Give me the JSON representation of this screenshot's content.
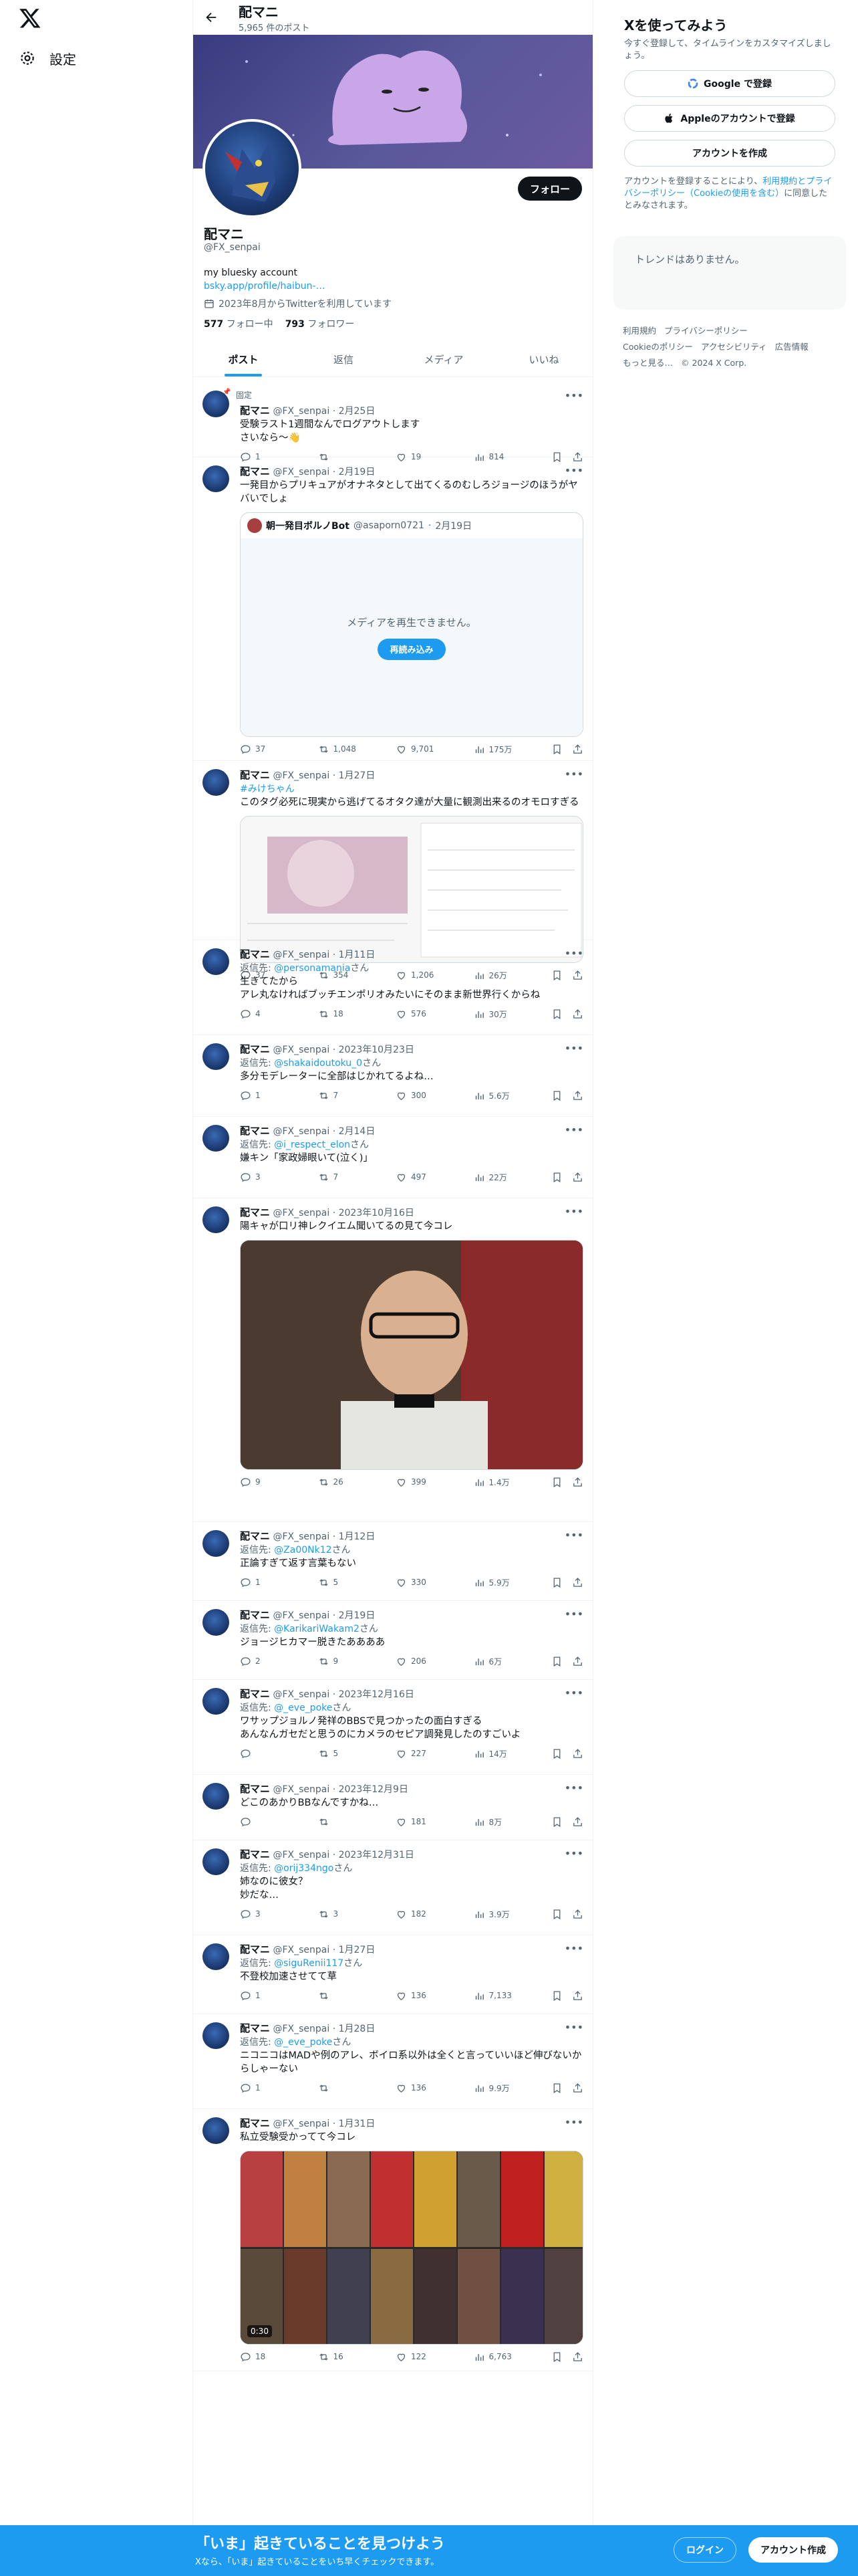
{
  "nav": {
    "settings": "設定"
  },
  "header": {
    "name": "配マニ",
    "posts": "5,965 件のポスト"
  },
  "profile": {
    "follow": "フォロー",
    "name": "配マニ",
    "handle": "@FX_senpai",
    "bio": "my bluesky account",
    "link": "bsky.app/profile/haibun-…",
    "joined": "2023年8月からTwitterを利用しています",
    "following_count": "577",
    "following_label": "フォロー中",
    "followers_count": "793",
    "followers_label": "フォロワー"
  },
  "tabs": [
    "ポスト",
    "返信",
    "メディア",
    "いいね"
  ],
  "tweets": [
    {
      "pinned": "固定",
      "name": "配マニ",
      "handle": "@FX_senpai",
      "date": "2月25日",
      "text": "受験ラスト1週間なんでログアウトします\nさいなら〜👋",
      "replies": "1",
      "rts": "",
      "likes": "19",
      "views": "814"
    },
    {
      "name": "配マニ",
      "handle": "@FX_senpai",
      "date": "2月19日",
      "text": "一発目からプリキュアがオナネタとして出てくるのむしろジョージのほうがヤバいでしょ",
      "quote": {
        "name": "朝一発目ボルノBot",
        "handle": "@asaporn0721",
        "date": "2月19日",
        "msg": "メディアを再生できません。",
        "btn": "再読み込み"
      },
      "replies": "37",
      "rts": "1,048",
      "likes": "9,701",
      "views": "175万"
    },
    {
      "name": "配マニ",
      "handle": "@FX_senpai",
      "date": "1月27日",
      "tag": "#みけちゃん",
      "text": "このタグ必死に現実から逃げてるオタク達が大量に観測出来るのオモロすぎる",
      "replies": "37",
      "rts": "354",
      "likes": "1,206",
      "views": "26万"
    },
    {
      "name": "配マニ",
      "handle": "@FX_senpai",
      "date": "1月11日",
      "reply_to": "@personamania",
      "text": "生きてたから\nアレ丸なければブッチエンポリオみたいにそのまま新世界行くからね",
      "replies": "4",
      "rts": "18",
      "likes": "576",
      "views": "30万"
    },
    {
      "name": "配マニ",
      "handle": "@FX_senpai",
      "date": "2023年10月23日",
      "reply_to": "@shakaidoutoku_0",
      "text": "多分モデレーターに全部はじかれてるよね…",
      "replies": "1",
      "rts": "7",
      "likes": "300",
      "views": "5.6万"
    },
    {
      "name": "配マニ",
      "handle": "@FX_senpai",
      "date": "2月14日",
      "reply_to": "@i_respect_elon",
      "text": "嫌キン「家政婦眼いて(泣く)」",
      "replies": "3",
      "rts": "7",
      "likes": "497",
      "views": "22万"
    },
    {
      "name": "配マニ",
      "handle": "@FX_senpai",
      "date": "2023年10月16日",
      "text": "陽キャが口リ神レクイエム聞いてるの見て今コレ",
      "replies": "9",
      "rts": "26",
      "likes": "399",
      "views": "1.4万"
    },
    {
      "name": "配マニ",
      "handle": "@FX_senpai",
      "date": "1月12日",
      "reply_to": "@Za00Nk12",
      "text": "正論すぎて返す言葉もない",
      "replies": "1",
      "rts": "5",
      "likes": "330",
      "views": "5.9万"
    },
    {
      "name": "配マニ",
      "handle": "@FX_senpai",
      "date": "2月19日",
      "reply_to": "@KarikariWakam2",
      "text": "ジョージヒカマー脱きたああああ",
      "replies": "2",
      "rts": "9",
      "likes": "206",
      "views": "6万"
    },
    {
      "name": "配マニ",
      "handle": "@FX_senpai",
      "date": "2023年12月16日",
      "reply_to": "@_eve_poke",
      "text": "ワサップジョルノ発祥のBBSで見つかったの面白すぎる\nあんなんガセだと思うのにカメラのセピア調発見したのすごいよ",
      "replies": "",
      "rts": "5",
      "likes": "227",
      "views": "14万"
    },
    {
      "name": "配マニ",
      "handle": "@FX_senpai",
      "date": "2023年12月9日",
      "text": "どこのあかりBBなんですかね…",
      "replies": "",
      "rts": "",
      "likes": "181",
      "views": "8万"
    },
    {
      "name": "配マニ",
      "handle": "@FX_senpai",
      "date": "2023年12月31日",
      "reply_to": "@orij334ngo",
      "text": "姉なのに彼女？\n妙だな…",
      "replies": "3",
      "rts": "3",
      "likes": "182",
      "views": "3.9万"
    },
    {
      "name": "配マニ",
      "handle": "@FX_senpai",
      "date": "1月27日",
      "reply_to": "@siguRenii117",
      "text": "不登校加速させてて草",
      "replies": "1",
      "rts": "",
      "likes": "136",
      "views": "7,133"
    },
    {
      "name": "配マニ",
      "handle": "@FX_senpai",
      "date": "1月28日",
      "reply_to": "@_eve_poke",
      "text": "ニコニコはMADや例のアレ、ボイロ系以外は全くと言っていいほど伸びないからしゃーない",
      "replies": "1",
      "rts": "",
      "likes": "136",
      "views": "9.9万"
    },
    {
      "name": "配マニ",
      "handle": "@FX_senpai",
      "date": "1月31日",
      "text": "私立受験受かってて今コレ",
      "video_time": "0:30",
      "replies": "18",
      "rts": "16",
      "likes": "122",
      "views": "6,763"
    }
  ],
  "reply_prefix": "返信先: ",
  "reply_suffix": "さん",
  "right": {
    "signup_title": "Xを使ってみよう",
    "signup_sub": "今すぐ登録して、タイムラインをカスタマイズしましょう。",
    "google": "Google で登録",
    "apple": "Appleのアカウントで登録",
    "create": "アカウントを作成",
    "fine_a": "アカウントを登録することにより、",
    "fine_link": "利用規約とプライバシーポリシー（Cookieの使用を含む）",
    "fine_b": "に同意したとみなされます。",
    "trends": "トレンドはありません。",
    "footer": [
      "利用規約",
      "プライバシーポリシー",
      "Cookieのポリシー",
      "アクセシビリティ",
      "広告情報",
      "もっと見る…",
      "© 2024 X Corp."
    ]
  },
  "bottom": {
    "title": "「いま」起きていることを見つけよう",
    "sub": "Xなら、「いま」起きていることをいち早くチェックできます。",
    "login": "ログイン",
    "create": "アカウント作成"
  }
}
